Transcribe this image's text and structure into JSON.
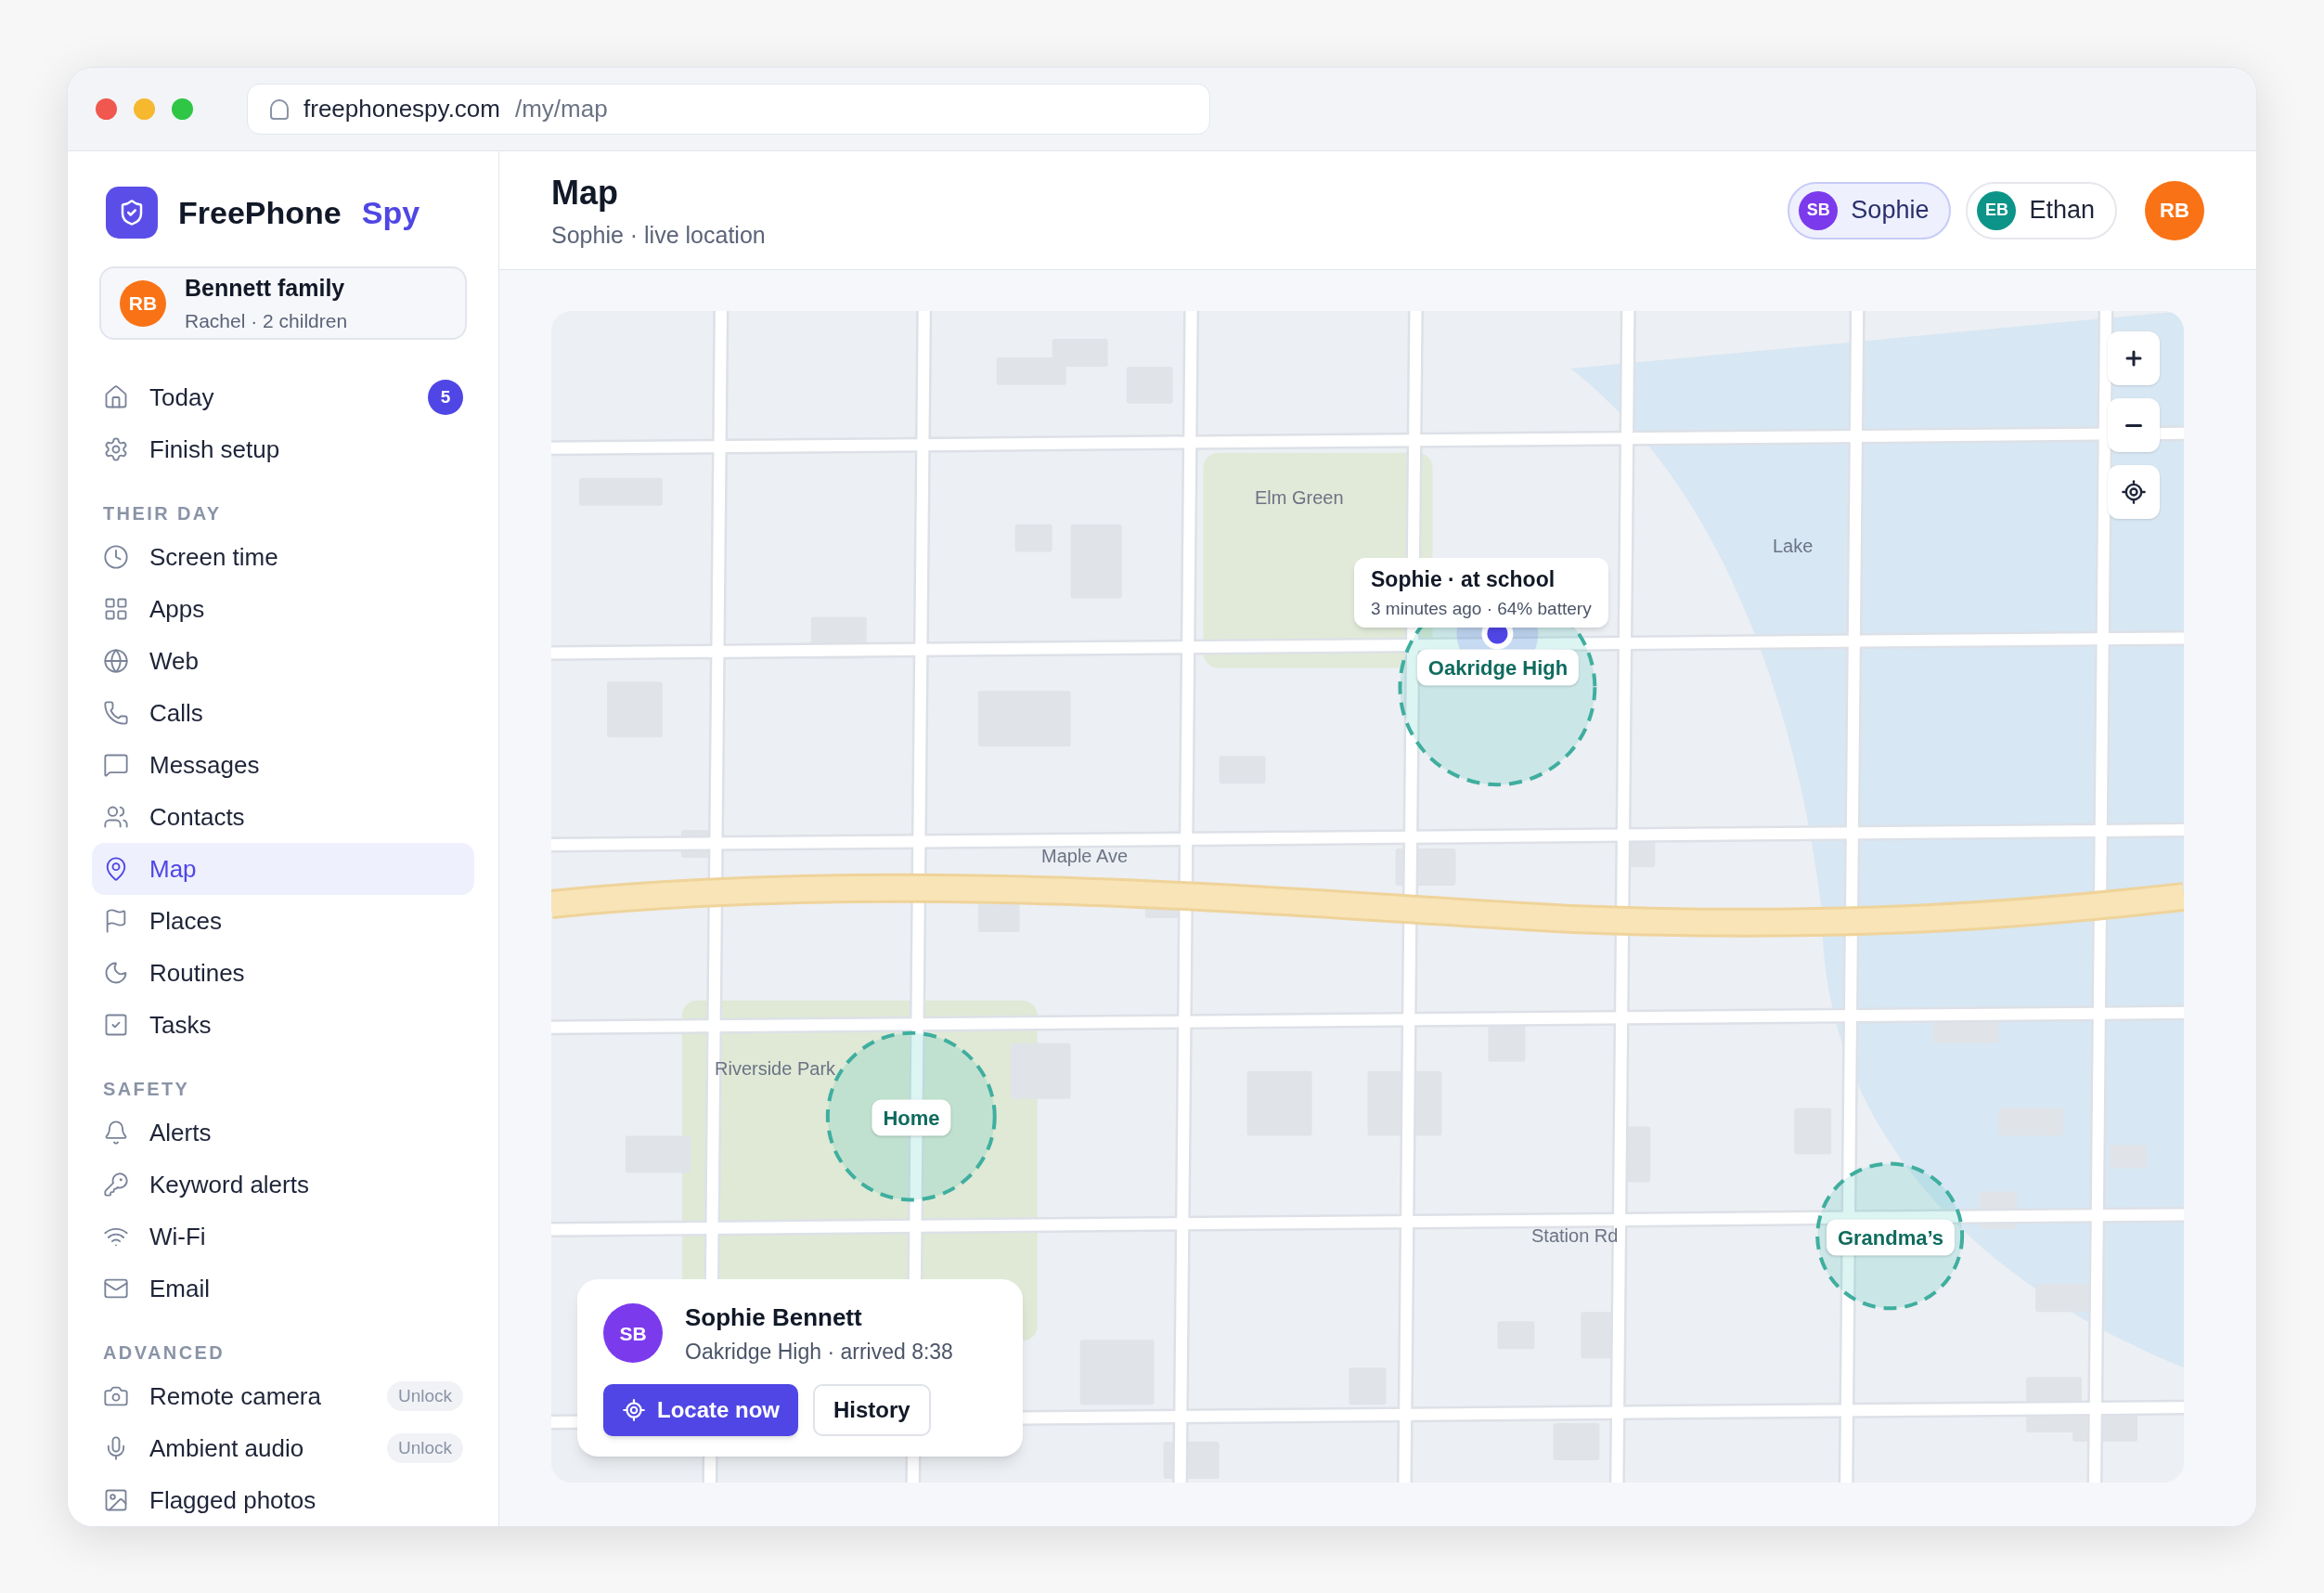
{
  "browser": {
    "url_domain": "freephonespy.com",
    "url_path": "/my/map"
  },
  "sidebar": {
    "brand": {
      "name": "FreePhone",
      "accent": "Spy"
    },
    "account": {
      "avatar": "RB",
      "name": "Bennett family",
      "subtitle": "Rachel · 2 children"
    },
    "top_items": [
      {
        "label": "Today",
        "badge": "5",
        "selected": false
      },
      {
        "label": "Finish setup",
        "selected": false
      }
    ],
    "sections": [
      {
        "heading": "THEIR DAY",
        "items": [
          {
            "label": "Screen time",
            "selected": false
          },
          {
            "label": "Apps",
            "selected": false
          },
          {
            "label": "Web",
            "selected": false
          },
          {
            "label": "Calls",
            "selected": false
          },
          {
            "label": "Messages",
            "selected": false
          },
          {
            "label": "Contacts",
            "selected": false
          },
          {
            "label": "Map",
            "selected": true
          },
          {
            "label": "Places",
            "selected": false
          },
          {
            "label": "Routines",
            "selected": false
          },
          {
            "label": "Tasks",
            "selected": false
          }
        ]
      },
      {
        "heading": "SAFETY",
        "items": [
          {
            "label": "Alerts",
            "selected": false
          },
          {
            "label": "Keyword alerts",
            "selected": false
          },
          {
            "label": "Wi-Fi",
            "selected": false
          },
          {
            "label": "Email",
            "selected": false
          }
        ]
      },
      {
        "heading": "ADVANCED",
        "items": [
          {
            "label": "Remote camera",
            "tag": "Unlock",
            "selected": false
          },
          {
            "label": "Ambient audio",
            "tag": "Unlock",
            "selected": false
          },
          {
            "label": "Flagged photos",
            "selected": false
          }
        ]
      }
    ]
  },
  "header": {
    "title": "Map",
    "subtitle": "Sophie · live location",
    "children": [
      {
        "initials": "SB",
        "name": "Sophie",
        "selected": true,
        "color": "#7c3aed"
      },
      {
        "initials": "EB",
        "name": "Ethan",
        "selected": false,
        "color": "#0d9488"
      }
    ],
    "user_avatar": "RB"
  },
  "map": {
    "labels": [
      "Elm Green",
      "Lake",
      "Maple Ave",
      "Riverside Park",
      "Station Rd"
    ],
    "places": [
      "Oakridge High",
      "Home",
      "Grandma’s"
    ],
    "callout": {
      "title": "Sophie · at school",
      "detail": "3 minutes ago · 64% battery"
    },
    "card": {
      "avatar": "SB",
      "name": "Sophie Bennett",
      "detail": "Oakridge High · arrived 8:38",
      "buttons": [
        "Locate now",
        "History"
      ]
    }
  }
}
